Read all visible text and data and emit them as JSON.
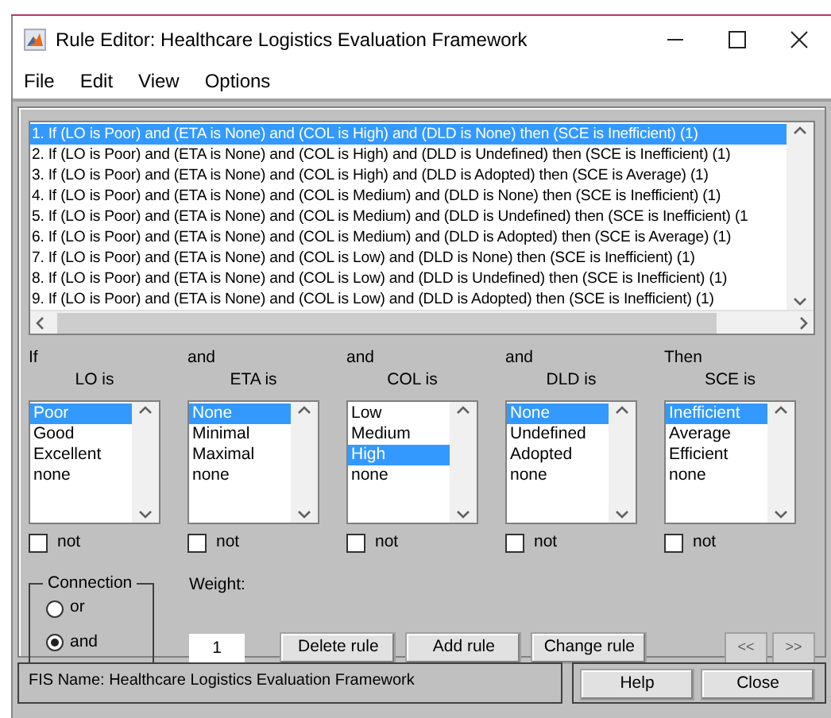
{
  "window": {
    "title": "Rule Editor: Healthcare Logistics Evaluation Framework"
  },
  "menu": [
    "File",
    "Edit",
    "View",
    "Options"
  ],
  "rules": [
    {
      "text": "1. If (LO is Poor) and (ETA is None) and (COL is High) and (DLD is None) then (SCE is Inefficient) (1)",
      "selected": true
    },
    {
      "text": "2. If (LO is Poor) and (ETA is None) and (COL is High) and (DLD is Undefined) then (SCE is Inefficient) (1)",
      "selected": false
    },
    {
      "text": "3. If (LO is Poor) and (ETA is None) and (COL is High) and (DLD is Adopted) then (SCE is Average) (1)",
      "selected": false
    },
    {
      "text": "4. If (LO is Poor) and (ETA is None) and (COL is Medium) and (DLD is None) then (SCE is Inefficient) (1)",
      "selected": false
    },
    {
      "text": "5. If (LO is Poor) and (ETA is None) and (COL is Medium) and (DLD is Undefined) then (SCE is Inefficient) (1",
      "selected": false
    },
    {
      "text": "6. If (LO is Poor) and (ETA is None) and (COL is Medium) and (DLD is Adopted) then (SCE is Average) (1)",
      "selected": false
    },
    {
      "text": "7. If (LO is Poor) and (ETA is None) and (COL is Low) and (DLD is None) then (SCE is Inefficient) (1)",
      "selected": false
    },
    {
      "text": "8. If (LO is Poor) and (ETA is None) and (COL is Low) and (DLD is Undefined) then (SCE is Inefficient) (1)",
      "selected": false
    },
    {
      "text": "9. If (LO is Poor) and (ETA is None) and (COL is Low) and (DLD is Adopted) then (SCE is Inefficient) (1)",
      "selected": false
    }
  ],
  "variables": [
    {
      "connector": "If",
      "label": "LO is",
      "not_label": "not",
      "not": false,
      "options": [
        {
          "label": "Poor",
          "selected": true
        },
        {
          "label": "Good",
          "selected": false
        },
        {
          "label": "Excellent",
          "selected": false
        },
        {
          "label": "none",
          "selected": false
        }
      ]
    },
    {
      "connector": "and",
      "label": "ETA is",
      "not_label": "not",
      "not": false,
      "options": [
        {
          "label": "None",
          "selected": true
        },
        {
          "label": "Minimal",
          "selected": false
        },
        {
          "label": "Maximal",
          "selected": false
        },
        {
          "label": "none",
          "selected": false
        }
      ]
    },
    {
      "connector": "and",
      "label": "COL is",
      "not_label": "not",
      "not": false,
      "options": [
        {
          "label": "Low",
          "selected": false
        },
        {
          "label": "Medium",
          "selected": false
        },
        {
          "label": "High",
          "selected": true
        },
        {
          "label": "none",
          "selected": false
        }
      ]
    },
    {
      "connector": "and",
      "label": "DLD is",
      "not_label": "not",
      "not": false,
      "options": [
        {
          "label": "None",
          "selected": true
        },
        {
          "label": "Undefined",
          "selected": false
        },
        {
          "label": "Adopted",
          "selected": false
        },
        {
          "label": "none",
          "selected": false
        }
      ]
    },
    {
      "connector": "Then",
      "label": "SCE is",
      "not_label": "not",
      "not": false,
      "options": [
        {
          "label": "Inefficient",
          "selected": true
        },
        {
          "label": "Average",
          "selected": false
        },
        {
          "label": "Efficient",
          "selected": false
        },
        {
          "label": "none",
          "selected": false
        }
      ]
    }
  ],
  "connection": {
    "title": "Connection",
    "options": [
      {
        "label": "or",
        "selected": false
      },
      {
        "label": "and",
        "selected": true
      }
    ]
  },
  "weight": {
    "label": "Weight:",
    "value": "1"
  },
  "actions": [
    "Delete rule",
    "Add rule",
    "Change rule"
  ],
  "nav": [
    {
      "label": "<<",
      "disabled": true
    },
    {
      "label": ">>",
      "disabled": true
    }
  ],
  "status": "FIS Name: Healthcare Logistics Evaluation Framework",
  "footer_buttons": [
    "Help",
    "Close"
  ]
}
